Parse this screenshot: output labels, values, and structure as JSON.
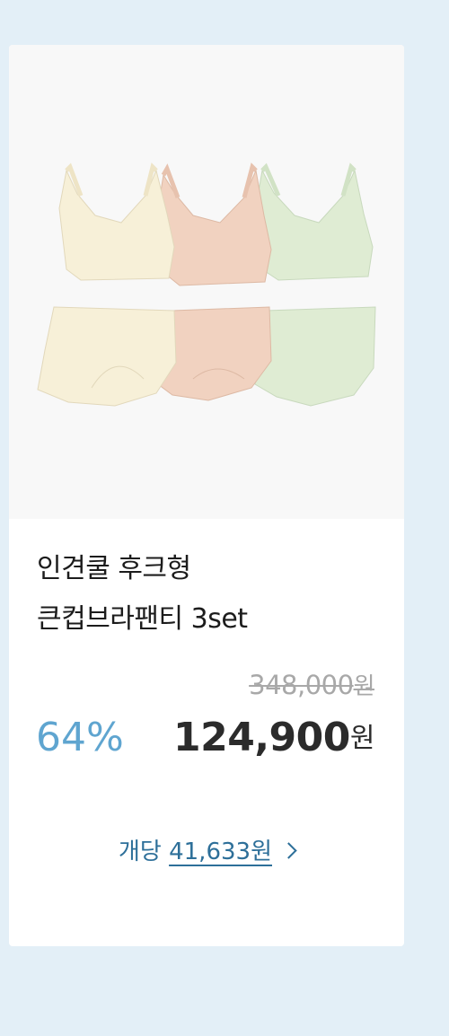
{
  "product": {
    "image_alt": "3-color bra and panty set (ivory, peach, mint)",
    "title_line1": "인견쿨 후크형",
    "title_line2": "큰컵브라팬티 3set",
    "original_price": "348,000",
    "currency": "원",
    "discount_rate": "64%",
    "sale_price": "124,900",
    "unit_price_label": "개당",
    "unit_price": "41,633원"
  },
  "colors": {
    "background": "#e3eff7",
    "discount": "#5fa5d0",
    "link": "#2d6f99",
    "ivory": "#f7f0d8",
    "peach": "#f1d2c0",
    "mint": "#dfecd3"
  }
}
